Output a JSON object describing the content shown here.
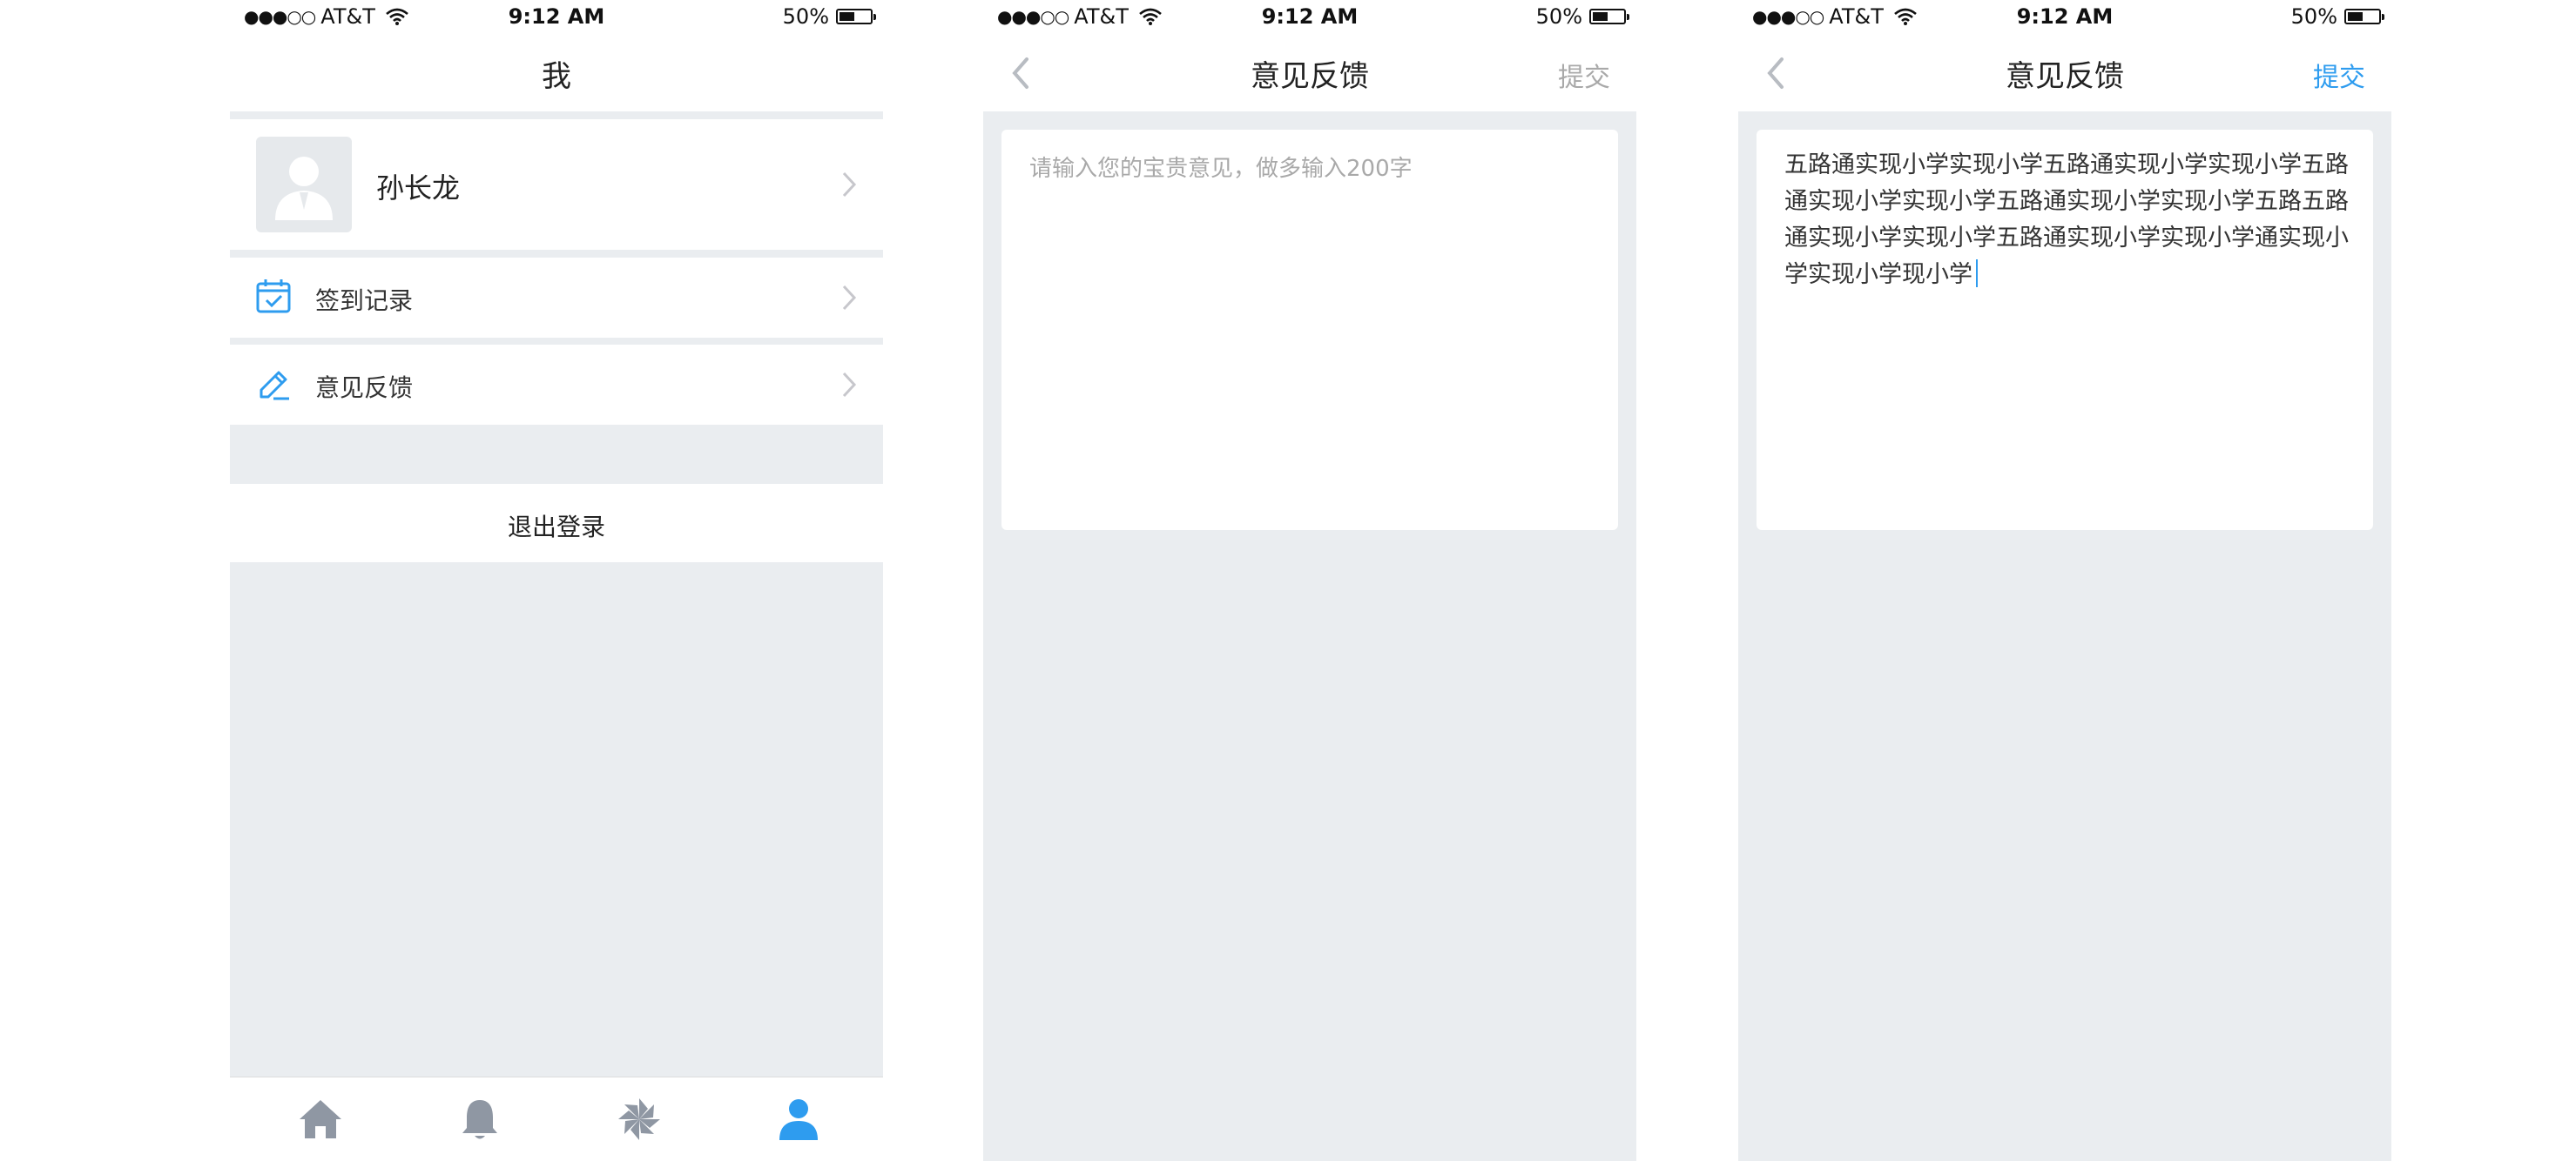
{
  "status_bar": {
    "signal_dots": "●●●○○",
    "carrier": "AT&T",
    "time": "9:12 AM",
    "battery_text": "50%",
    "battery_level": 0.5
  },
  "screens": [
    {
      "title": "我",
      "profile": {
        "name": "孙长龙",
        "avatar": "user-avatar-placeholder"
      },
      "menu": [
        {
          "label": "签到记录",
          "icon": "calendar-check-icon"
        },
        {
          "label": "意见反馈",
          "icon": "pencil-edit-icon"
        }
      ],
      "logout_label": "退出登录",
      "tabs": [
        {
          "icon": "home-icon",
          "active": false
        },
        {
          "icon": "bell-icon",
          "active": false
        },
        {
          "icon": "pinwheel-icon",
          "active": false
        },
        {
          "icon": "user-icon",
          "active": true
        }
      ]
    },
    {
      "title": "意见反馈",
      "action_label": "提交",
      "action_enabled": false,
      "placeholder": "请输入您的宝贵意见，做多输入200字"
    },
    {
      "title": "意见反馈",
      "action_label": "提交",
      "action_enabled": true,
      "value": "五路通实现小学实现小学五路通实现小学实现小学五路通实现小学实现小学五路通实现小学实现小学五路五路通实现小学实现小学五路通实现小学实现小学通实现小学实现小学现小学"
    }
  ],
  "colors": {
    "accent": "#2e9cef",
    "icon_gray": "#8f97a3",
    "background": "#eaedf0",
    "disabled_text": "#a9a9a9"
  }
}
